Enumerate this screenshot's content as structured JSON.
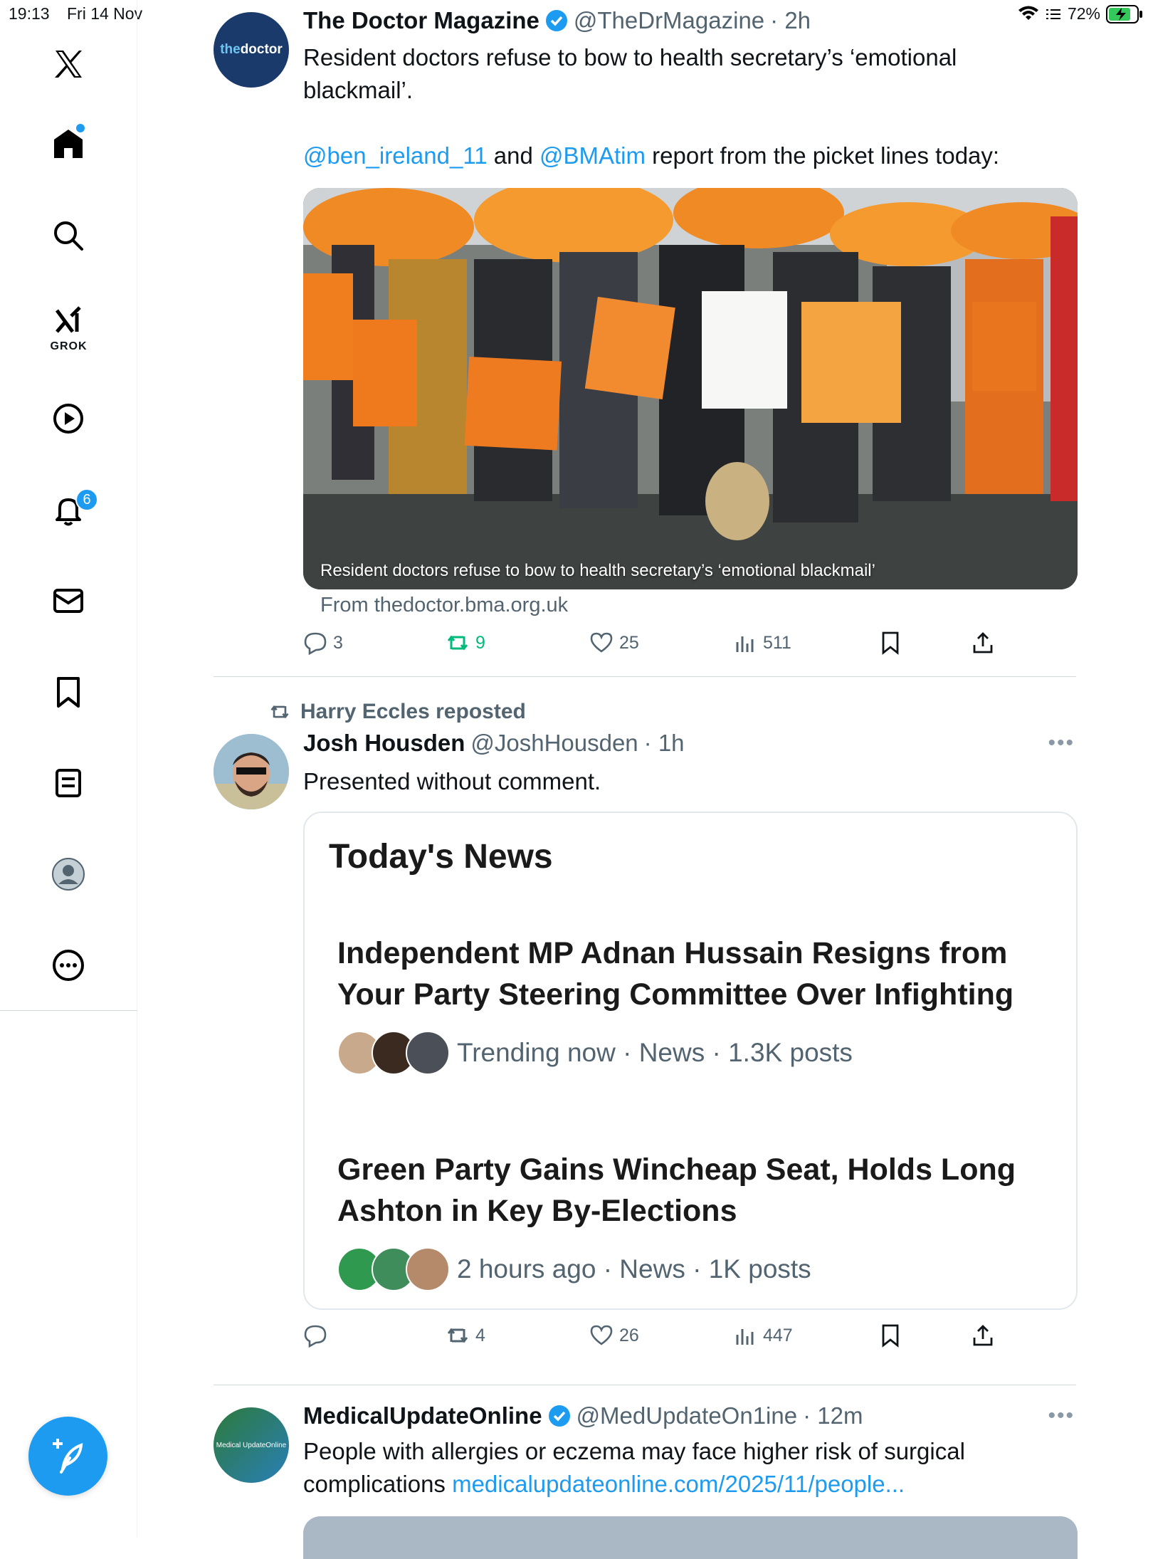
{
  "status_bar": {
    "time": "19:13",
    "date": "Fri 14 Nov",
    "battery": "72%"
  },
  "sidebar": {
    "items": [
      "x-logo",
      "home",
      "search",
      "grok",
      "video",
      "notifications",
      "messages",
      "bookmarks",
      "lists",
      "profile",
      "more"
    ],
    "grok_label": "GROK",
    "notification_count": "6"
  },
  "tweets": [
    {
      "name": "The Doctor Magazine",
      "handle": "@TheDrMagazine",
      "time": "· 2h",
      "avatar_text_a": "the",
      "avatar_text_b": "doctor",
      "text_line1": "Resident doctors refuse to bow to health secretary’s ‘emotional",
      "text_line2": "blackmail’.",
      "mention1": "@ben_ireland_11",
      "and": " and ",
      "mention2": "@BMAtim",
      "text_rest": " report from the picket lines today:",
      "image_caption": "Resident doctors refuse to bow to health secretary’s ‘emotional blackmail’",
      "link_source": "From thedoctor.bma.org.uk",
      "replies": "3",
      "reposts": "9",
      "likes": "25",
      "views": "511"
    },
    {
      "reposted_by": "Harry Eccles reposted",
      "name": "Josh Housden",
      "handle": "@JoshHousden",
      "time": "· 1h",
      "text": "Presented without comment.",
      "card": {
        "title": "Today's News",
        "stories": [
          {
            "headline": "Independent MP Adnan Hussain Resigns from Your Party Steering Committee Over Infighting",
            "meta": "Trending now · News · 1.3K posts"
          },
          {
            "headline": "Green Party Gains Wincheap Seat, Holds Long Ashton in Key By-Elections",
            "meta": "2 hours ago · News · 1K posts"
          }
        ]
      },
      "replies": "",
      "reposts": "4",
      "likes": "26",
      "views": "447"
    },
    {
      "name": "MedicalUpdateOnline",
      "handle": "@MedUpdateOn1ine",
      "time": "· 12m",
      "avatar_text": "Medical UpdateOnline",
      "text_line1": "People with allergies or eczema may face higher risk of surgical",
      "text_line2_a": "complications ",
      "link": "medicalupdateonline.com/2025/11/people..."
    }
  ],
  "colors": {
    "accent": "#1d9bf0",
    "repost_green": "#00ba7c",
    "text_secondary": "#536471"
  }
}
